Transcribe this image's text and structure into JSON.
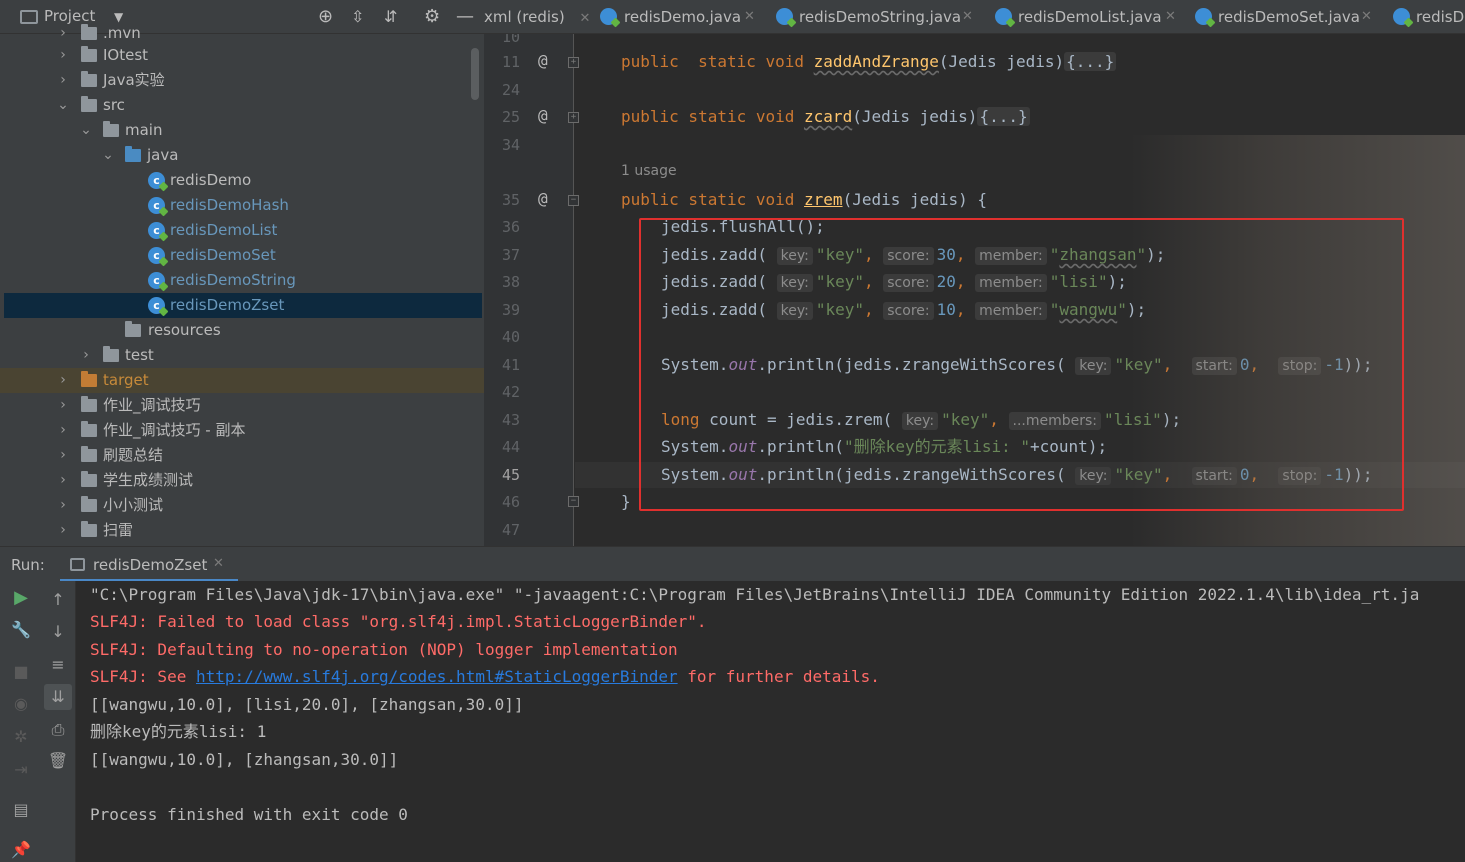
{
  "project_panel": {
    "title": "Project",
    "tree": [
      {
        "label": ".mvn",
        "kind": "folder",
        "chevron": ">"
      },
      {
        "label": "IOtest",
        "kind": "folder",
        "chevron": ">"
      },
      {
        "label": "Java实验",
        "kind": "folder",
        "chevron": ">"
      },
      {
        "label": "src",
        "kind": "folder",
        "chevron": "v"
      },
      {
        "label": "main",
        "kind": "folder",
        "chevron": "v"
      },
      {
        "label": "java",
        "kind": "folder-blue",
        "chevron": "v"
      },
      {
        "label": "redisDemo",
        "kind": "class"
      },
      {
        "label": "redisDemoHash",
        "kind": "class"
      },
      {
        "label": "redisDemoList",
        "kind": "class"
      },
      {
        "label": "redisDemoSet",
        "kind": "class"
      },
      {
        "label": "redisDemoString",
        "kind": "class"
      },
      {
        "label": "redisDemoZset",
        "kind": "class",
        "selected": true
      },
      {
        "label": "resources",
        "kind": "folder-res"
      },
      {
        "label": "test",
        "kind": "folder",
        "chevron": ">"
      },
      {
        "label": "target",
        "kind": "folder-orange",
        "chevron": ">"
      },
      {
        "label": "作业_调试技巧",
        "kind": "folder",
        "chevron": ">"
      },
      {
        "label": "作业_调试技巧 - 副本",
        "kind": "folder",
        "chevron": ">"
      },
      {
        "label": "刷题总结",
        "kind": "folder",
        "chevron": ">"
      },
      {
        "label": "学生成绩测试",
        "kind": "folder",
        "chevron": ">"
      },
      {
        "label": "小小测试",
        "kind": "folder",
        "chevron": ">"
      },
      {
        "label": "扫雷",
        "kind": "folder",
        "chevron": ">"
      }
    ]
  },
  "tabs": [
    {
      "label": "xml (redis)"
    },
    {
      "label": "redisDemo.java"
    },
    {
      "label": "redisDemoString.java"
    },
    {
      "label": "redisDemoList.java"
    },
    {
      "label": "redisDemoSet.java"
    },
    {
      "label": "redisDe"
    }
  ],
  "editor": {
    "line_numbers": [
      "10",
      "11",
      "24",
      "25",
      "34",
      "35",
      "36",
      "37",
      "38",
      "39",
      "40",
      "41",
      "42",
      "43",
      "44",
      "45",
      "46",
      "47"
    ],
    "usage_hint": "1 usage",
    "code": {
      "l11_kw": "public  static void ",
      "l11_name": "zaddAndZrange",
      "l11_rest": "(Jedis jedis)",
      "l11_fold": "{...}",
      "l25_kw": "public static void ",
      "l25_name": "zcard",
      "l25_rest": "(Jedis jedis)",
      "l25_fold": "{...}",
      "l35_kw": "public static void ",
      "l35_name": "zrem",
      "l35_rest": "(Jedis jedis) {",
      "l36": "jedis.flushAll();",
      "zadd_call": "jedis.zadd(",
      "hint_key": "key:",
      "hint_score": "score:",
      "hint_member": "member:",
      "hint_start": "start:",
      "hint_stop": "stop:",
      "hint_members": "...members:",
      "str_key": "\"key\"",
      "l37_score": "30",
      "l37_member": "zhangsan",
      "l38_score": "20",
      "l38_member": "lisi",
      "l39_score": "10",
      "l39_member": "wangwu",
      "sys": "System.",
      "out": "out",
      "println_zrange": ".println(jedis.zrangeWithScores(",
      "num_0": "0",
      "num_m1": "-1",
      "close_call": "));",
      "l43_kw": "long ",
      "l43_mid": "count = jedis.zrem(",
      "l43_str": "\"lisi\"",
      "l43_end": ");",
      "l44_mid": ".println(",
      "l44_str": "\"删除key的元素lisi: \"",
      "l44_end": "+count);",
      "l46": "}",
      "quote": "\"",
      "comma": ", ",
      "close_paren": ");"
    }
  },
  "run_panel": {
    "label": "Run:",
    "tab": "redisDemoZset",
    "console": [
      {
        "text": "\"C:\\Program Files\\Java\\jdk-17\\bin\\java.exe\" \"-javaagent:C:\\Program Files\\JetBrains\\IntelliJ IDEA Community Edition 2022.1.4\\lib\\idea_rt.ja",
        "kind": "out"
      },
      {
        "text": "SLF4J: Failed to load class \"org.slf4j.impl.StaticLoggerBinder\".",
        "kind": "err"
      },
      {
        "text": "SLF4J: Defaulting to no-operation (NOP) logger implementation",
        "kind": "err"
      },
      {
        "text": "SLF4J: See ",
        "kind": "err",
        "link": "http://www.slf4j.org/codes.html#StaticLoggerBinder",
        "after": " for further details."
      },
      {
        "text": "[[wangwu,10.0], [lisi,20.0], [zhangsan,30.0]]",
        "kind": "out"
      },
      {
        "text": "删除key的元素lisi: 1",
        "kind": "out"
      },
      {
        "text": "[[wangwu,10.0], [zhangsan,30.0]]",
        "kind": "out"
      },
      {
        "text": "",
        "kind": "out"
      },
      {
        "text": "Process finished with exit code 0",
        "kind": "out"
      }
    ]
  },
  "colors": {
    "keyword": "#cc7832",
    "string": "#6a8759",
    "number": "#6897bb",
    "static_field": "#9876aa",
    "error_text": "#ff6b68",
    "link": "#287bde",
    "highlight_box": "#e0302e"
  }
}
